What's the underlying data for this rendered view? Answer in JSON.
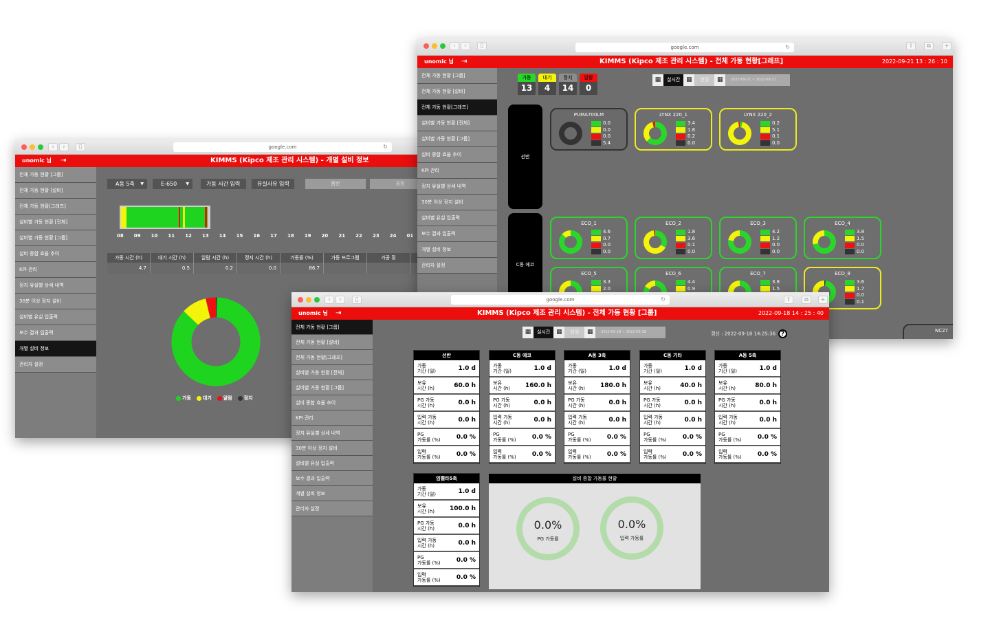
{
  "browser": {
    "url": "google.com"
  },
  "app": {
    "user": "unomic 님",
    "title_base": "KIMMS (Kipco 제조 관리 시스템)"
  },
  "sidebar_items": [
    "전체 가동 현황 [그룹]",
    "전체 가동 현황 [설비]",
    "전체 가동 현황[그래프]",
    "설비별 가동 현황 [전체]",
    "설비별 가동 현황 [그룹]",
    "설비 종합 효율 추이",
    "KPI 관리",
    "정지 유실별 상세 내역",
    "30분 이상 정지 설비",
    "설비별 유실 입출력",
    "보수 결과 입출력",
    "개별 설비 정보",
    "관리자 설정"
  ],
  "win_equipment": {
    "title": "KIMMS (Kipco 제조 관리 시스템) - 개별 설비 정보",
    "group_select": "A동 5축",
    "machine_select": "E-650",
    "btn_runtime": "가동 시간 입력",
    "btn_loss": "유실사유 입력",
    "btn_product": "품번",
    "btn_process": "공정",
    "timeline_hours": [
      "08",
      "09",
      "10",
      "11",
      "12",
      "13",
      "14",
      "15",
      "16",
      "17",
      "18",
      "19",
      "20",
      "21",
      "22",
      "23",
      "24",
      "01"
    ],
    "table_headers": [
      "가동 시간 (h)",
      "대기 시간 (h)",
      "알람 시간 (h)",
      "정지 시간 (h)",
      "가동률 (%)",
      "가동 프로그램",
      "가공 횟"
    ],
    "table_values": [
      "4.7",
      "0.5",
      "0.2",
      "0.0",
      "86.7",
      "",
      ""
    ],
    "donut": {
      "run": 86.7,
      "wait": 9.2,
      "alarm": 3.7,
      "stop": 0.4
    },
    "legend": [
      "가동",
      "대기",
      "알람",
      "정지"
    ]
  },
  "win_graph": {
    "title": "KIMMS (Kipco 제조 관리 시스템) - 전체 가동 현황[그래프]",
    "clock": "2022-09-21 13 : 26 : 10",
    "badges": [
      {
        "label": "가동",
        "count": "13",
        "color": "#2bd62b"
      },
      {
        "label": "대기",
        "count": "4",
        "color": "#f4f40a"
      },
      {
        "label": "정지",
        "count": "14",
        "color": "#8c8c8c"
      },
      {
        "label": "알람",
        "count": "0",
        "color": "#ee1111"
      }
    ],
    "realtime": "실시간",
    "monthly": "현월",
    "date_range": "2022-09-21 ~ 2022-09-21",
    "groups": [
      "선반",
      "C동 에코"
    ],
    "machines": [
      {
        "name": "PUMA700LM",
        "vals": [
          "0.0",
          "0.0",
          "0.0",
          "5.4"
        ],
        "border": "#333333"
      },
      {
        "name": "LYNX 220_1",
        "vals": [
          "3.4",
          "1.8",
          "0.2",
          "0.0"
        ],
        "border": "#ecec20"
      },
      {
        "name": "LYNX 220_2",
        "vals": [
          "0.2",
          "5.1",
          "0.1",
          "0.0"
        ],
        "border": "#ecec20"
      },
      {
        "name": "ECO_1",
        "vals": [
          "4.6",
          "0.7",
          "0.0",
          "0.0"
        ],
        "border": "#2bd62b"
      },
      {
        "name": "ECO_2",
        "vals": [
          "1.8",
          "3.6",
          "0.1",
          "0.0"
        ],
        "border": "#2bd62b"
      },
      {
        "name": "ECO_3",
        "vals": [
          "4.2",
          "1.2",
          "0.0",
          "0.0"
        ],
        "border": "#2bd62b"
      },
      {
        "name": "ECO_4",
        "vals": [
          "3.8",
          "1.5",
          "0.0",
          "0.0"
        ],
        "border": "#2bd62b"
      },
      {
        "name": "ECO_5",
        "vals": [
          "3.3",
          "2.0"
        ],
        "border": "#2bd62b"
      },
      {
        "name": "ECO_6",
        "vals": [
          "4.4",
          "0.9"
        ],
        "border": "#2bd62b"
      },
      {
        "name": "ECO_7",
        "vals": [
          "3.8",
          "1.5"
        ],
        "border": "#2bd62b"
      },
      {
        "name": "ECO_8",
        "vals": [
          "3.6",
          "1.7",
          "0.0",
          "0.1"
        ],
        "border": "#ecec20"
      }
    ],
    "partial_card": "NC27"
  },
  "win_group": {
    "title": "KIMMS (Kipco 제조 관리 시스템) - 전체 가동 현황 [그룹]",
    "clock": "2022-09-18 14 : 25 : 40",
    "realtime": "실시간",
    "monthly": "현월",
    "date_range": "2022-09-18 ~ 2022-09-18",
    "updated": "갱신 : 2022-09-18 14:25:36",
    "help": "?",
    "row_labels": [
      [
        "가동",
        "기간 (일)"
      ],
      [
        "보유",
        "시간 (h)"
      ],
      [
        "PG 가동",
        "시간 (h)"
      ],
      [
        "입력 가동",
        "시간 (h)"
      ],
      [
        "PG",
        "가동률 (%)"
      ],
      [
        "입력",
        "가동률 (%)"
      ]
    ],
    "groups": [
      {
        "name": "선반",
        "vals": [
          "1.0 d",
          "60.0 h",
          "0.0 h",
          "0.0 h",
          "0.0 %",
          "0.0 %"
        ]
      },
      {
        "name": "C동 에코",
        "vals": [
          "1.0 d",
          "160.0 h",
          "0.0 h",
          "0.0 h",
          "0.0 %",
          "0.0 %"
        ]
      },
      {
        "name": "A동 3축",
        "vals": [
          "1.0 d",
          "180.0 h",
          "0.0 h",
          "0.0 h",
          "0.0 %",
          "0.0 %"
        ]
      },
      {
        "name": "C동 기타",
        "vals": [
          "1.0 d",
          "40.0 h",
          "0.0 h",
          "0.0 h",
          "0.0 %",
          "0.0 %"
        ]
      },
      {
        "name": "A동 5축",
        "vals": [
          "1.0 d",
          "80.0 h",
          "0.0 h",
          "0.0 h",
          "0.0 %",
          "0.0 %"
        ]
      },
      {
        "name": "임펠라5축",
        "vals": [
          "1.0 d",
          "100.0 h",
          "0.0 h",
          "0.0 h",
          "0.0 %",
          "0.0 %"
        ]
      }
    ],
    "summary": {
      "title": "설비 종합 가동률 현황",
      "pg_value": "0.0%",
      "pg_label": "PG 가동률",
      "input_value": "0.0%",
      "input_label": "입력 가동률"
    }
  }
}
